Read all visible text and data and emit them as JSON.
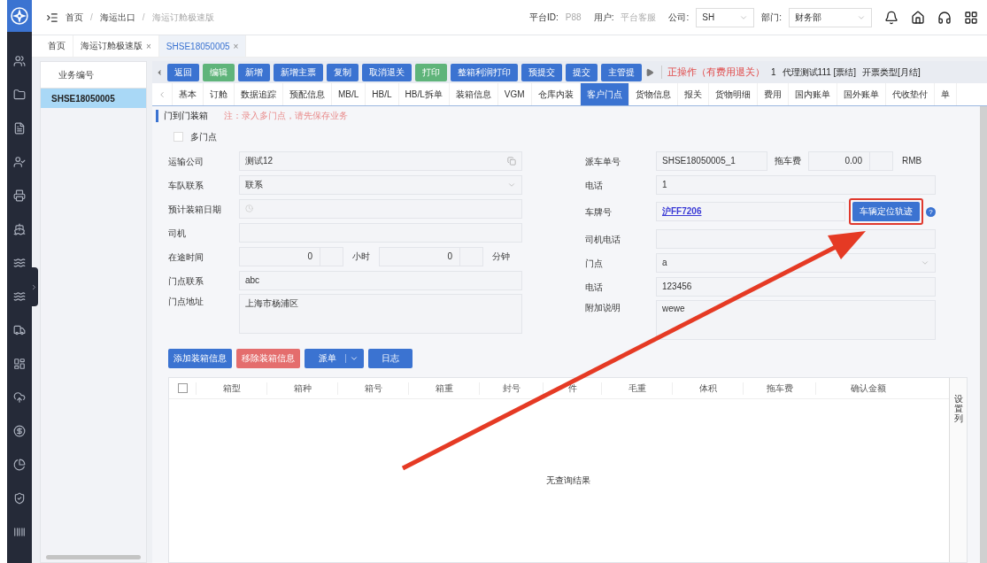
{
  "breadcrumb": [
    {
      "label": "首页",
      "current": false
    },
    {
      "label": "海运出口",
      "current": false,
      "separator": "/"
    },
    {
      "label": "海运订舱极速版",
      "current": true,
      "separator": "/"
    }
  ],
  "header": {
    "platform_label": "平台ID:",
    "platform_id": "P88",
    "user_label": "用户:",
    "user": "平台客服",
    "company_label": "公司:",
    "company": "SH",
    "dept_label": "部门:",
    "dept": "财务部"
  },
  "page_tabs": [
    {
      "label": "首页",
      "selected": false
    },
    {
      "label": "海运订舱极速版",
      "selected": false,
      "close": "×"
    },
    {
      "label": "SHSE18050005",
      "selected": true,
      "close": "×"
    }
  ],
  "record_list": {
    "heading": "业务编号",
    "items": [
      {
        "label": "SHSE18050005",
        "selected": true
      }
    ]
  },
  "toolbar": {
    "buttons": [
      {
        "label": "返回",
        "color": "#3b73d1"
      },
      {
        "label": "编辑",
        "color": "#5fb47a"
      },
      {
        "label": "新增",
        "color": "#3b73d1"
      },
      {
        "label": "新增主票",
        "color": "#3b73d1"
      },
      {
        "label": "复制",
        "color": "#3b73d1"
      },
      {
        "label": "取消退关",
        "color": "#3b73d1"
      },
      {
        "label": "打印",
        "color": "#5fb47a"
      },
      {
        "label": "整箱利润打印",
        "color": "#3b73d1"
      },
      {
        "label": "预提交",
        "color": "#3b73d1"
      },
      {
        "label": "提交",
        "color": "#3b73d1"
      },
      {
        "label": "主管提",
        "color": "#3b73d1"
      }
    ],
    "status": "正操作（有费用退关）",
    "count": "1",
    "agent": "代理测试111 [票结]",
    "invoice_type": "开票类型[月结]"
  },
  "detail_tabs": [
    {
      "label": "基本",
      "selected": false
    },
    {
      "label": "订舱",
      "selected": false
    },
    {
      "label": "数据追踪",
      "selected": false
    },
    {
      "label": "预配信息",
      "selected": false
    },
    {
      "label": "MB/L",
      "selected": false
    },
    {
      "label": "HB/L",
      "selected": false
    },
    {
      "label": "HB/L拆单",
      "selected": false
    },
    {
      "label": "装箱信息",
      "selected": false
    },
    {
      "label": "VGM",
      "selected": false
    },
    {
      "label": "仓库内装",
      "selected": false
    },
    {
      "label": "客户门点",
      "selected": true
    },
    {
      "label": "货物信息",
      "selected": false
    },
    {
      "label": "报关",
      "selected": false
    },
    {
      "label": "货物明细",
      "selected": false
    },
    {
      "label": "费用",
      "selected": false
    },
    {
      "label": "国内账单",
      "selected": false
    },
    {
      "label": "国外账单",
      "selected": false
    },
    {
      "label": "代收垫付",
      "selected": false
    },
    {
      "label": "单",
      "selected": false
    }
  ],
  "section": {
    "title": "门到门装箱",
    "note": "注：录入多门点，请先保存业务"
  },
  "multi_door": {
    "label": "多门点",
    "checked": false
  },
  "left_fields": [
    {
      "label": "运输公司",
      "kind": "lookup",
      "value": "测试12"
    },
    {
      "label": "车队联系",
      "kind": "select",
      "value": "联系"
    },
    {
      "label": "预计装箱日期",
      "kind": "date"
    },
    {
      "label": "司机",
      "kind": "text"
    },
    {
      "label": "在途时间",
      "kind": "duration",
      "hours": "0",
      "hours_unit": "小时",
      "minutes": "0",
      "minutes_unit": "分钟"
    },
    {
      "label": "门点联系",
      "kind": "text",
      "value": "abc"
    },
    {
      "label": "门点地址",
      "kind": "textarea",
      "value": "上海市杨浦区"
    }
  ],
  "right_fields": [
    {
      "label": "派车单号",
      "kind": "order",
      "value": "SHSE18050005_1",
      "fee_label": "拖车费",
      "fee": "0.00",
      "currency": "RMB"
    },
    {
      "label": "电话",
      "kind": "text",
      "value": "1"
    },
    {
      "label": "车牌号",
      "kind": "plate",
      "value": "沪FF7206",
      "button": "车辆定位轨迹",
      "help": "?"
    },
    {
      "label": "司机电话",
      "kind": "text"
    },
    {
      "label": "门点",
      "kind": "select",
      "value": "a"
    },
    {
      "label": "电话",
      "kind": "text",
      "value": "123456"
    },
    {
      "label": "附加说明",
      "kind": "textarea",
      "value": "wewe"
    }
  ],
  "actions": [
    {
      "label": "添加装箱信息",
      "kind": "primary"
    },
    {
      "label": "移除装箱信息",
      "kind": "danger"
    },
    {
      "label": "派单",
      "kind": "split"
    },
    {
      "label": "日志",
      "kind": "primary"
    }
  ],
  "table": {
    "select_all": false,
    "columns": [
      "箱型",
      "箱种",
      "箱号",
      "箱重",
      "封号",
      "件",
      "毛重",
      "体积",
      "拖车费",
      "确认金额"
    ],
    "settings": "设置列",
    "empty": "无查询结果"
  }
}
